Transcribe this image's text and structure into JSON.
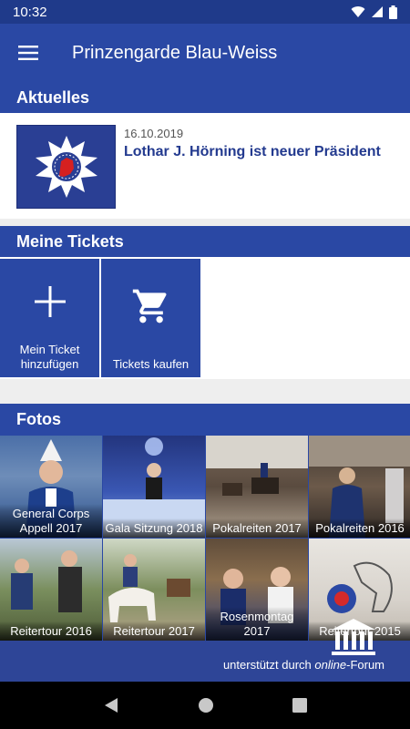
{
  "status_bar": {
    "time": "10:32"
  },
  "app_bar": {
    "title": "Prinzengarde Blau-Weiss"
  },
  "sections": {
    "news_title": "Aktuelles",
    "tickets_title": "Meine Tickets",
    "photos_title": "Fotos"
  },
  "news": [
    {
      "date": "16.10.2019",
      "headline": "Lothar J. Hörning ist neuer Präsident"
    }
  ],
  "tickets": [
    {
      "label_line1": "Mein Ticket",
      "label_line2": "hinzufügen",
      "icon": "plus-icon"
    },
    {
      "label_line1": "Tickets kaufen",
      "label_line2": "",
      "icon": "shopping-cart-icon"
    }
  ],
  "photos": [
    {
      "caption_line1": "General Corps",
      "caption_line2": "Appell 2017"
    },
    {
      "caption_line1": "Gala Sitzung 2018",
      "caption_line2": ""
    },
    {
      "caption_line1": "Pokalreiten 2017",
      "caption_line2": ""
    },
    {
      "caption_line1": "Pokalreiten 2016",
      "caption_line2": ""
    },
    {
      "caption_line1": "Reitertour 2016",
      "caption_line2": ""
    },
    {
      "caption_line1": "Reitertour 2017",
      "caption_line2": ""
    },
    {
      "caption_line1": "Rosenmontag",
      "caption_line2": "2017"
    },
    {
      "caption_line1": "Reitertour 2015",
      "caption_line2": ""
    }
  ],
  "sponsor": {
    "prefix": "unterstützt durch ",
    "brand": "online",
    "suffix": "-Forum"
  },
  "colors": {
    "primary": "#2a48a4",
    "status_bar": "#1f3a8a",
    "headline": "#233a8f"
  }
}
